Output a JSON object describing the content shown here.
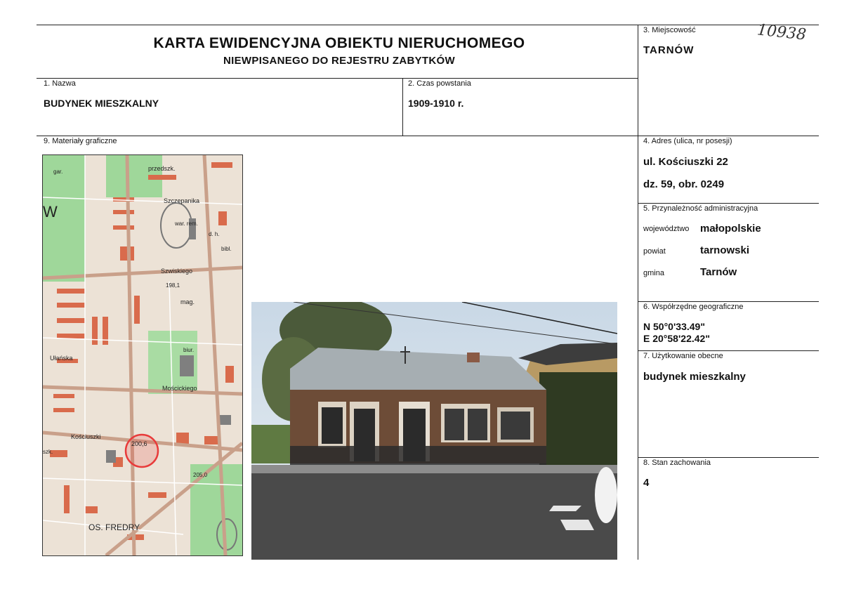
{
  "header": {
    "title": "KARTA EWIDENCYJNA OBIEKTU NIERUCHOMEGO",
    "subtitle": "NIEWPISANEGO DO REJESTRU ZABYTKÓW",
    "handwritten_number": "10938"
  },
  "fields": {
    "nazwa": {
      "label": "1. Nazwa",
      "value": "BUDYNEK MIESZKALNY"
    },
    "czas": {
      "label": "2. Czas powstania",
      "value": "1909-1910 r."
    },
    "miejscowosc": {
      "label": "3. Miejscowość",
      "value": "TARNÓW"
    },
    "adres": {
      "label": "4. Adres (ulica, nr posesji)",
      "street": "ul. Kościuszki 22",
      "plot": "dz. 59, obr. 0249"
    },
    "przynaleznosc": {
      "label": "5. Przynależność administracyjna",
      "wojewodztwo_label": "województwo",
      "wojewodztwo": "małopolskie",
      "powiat_label": "powiat",
      "powiat": "tarnowski",
      "gmina_label": "gmina",
      "gmina": "Tarnów"
    },
    "wspolrzedne": {
      "label": "6. Współrzędne geograficzne",
      "lat": "N 50°0'33.49\"",
      "lon": "E 20°58'22.42\""
    },
    "uzytkowanie": {
      "label": "7. Użytkowanie obecne",
      "value": "budynek mieszkalny"
    },
    "stan": {
      "label": "8. Stan zachowania",
      "value": "4"
    },
    "materialy": {
      "label": "9. Materiały graficzne"
    }
  },
  "map": {
    "labels": {
      "przedszk": "przedszk.",
      "szczepanika": "Szczepanika",
      "war_rem": "war. rem.",
      "szwiskiego": "Szwiskiego",
      "mag": "mag.",
      "biur": "biur.",
      "ulanska": "Ułańska",
      "moscickiego": "Mościckiego",
      "kosciuszki": "Kościuszki",
      "marker": "200,6",
      "fredry": "OS. FREDRY",
      "w": "W",
      "elev1": "198,1",
      "elev2": "205,0",
      "gar": "gar.",
      "dh": "d. h.",
      "bibl": "bibl.",
      "szk": "szk."
    }
  },
  "colors": {
    "map_building": "#d96b4c",
    "map_block": "#e6d6c4",
    "map_green": "#8ecf8a",
    "map_marker": "#e83a3a",
    "sky": "#dfe7ec",
    "house_wall": "#6b4a36",
    "roof": "#9aa3a8"
  }
}
